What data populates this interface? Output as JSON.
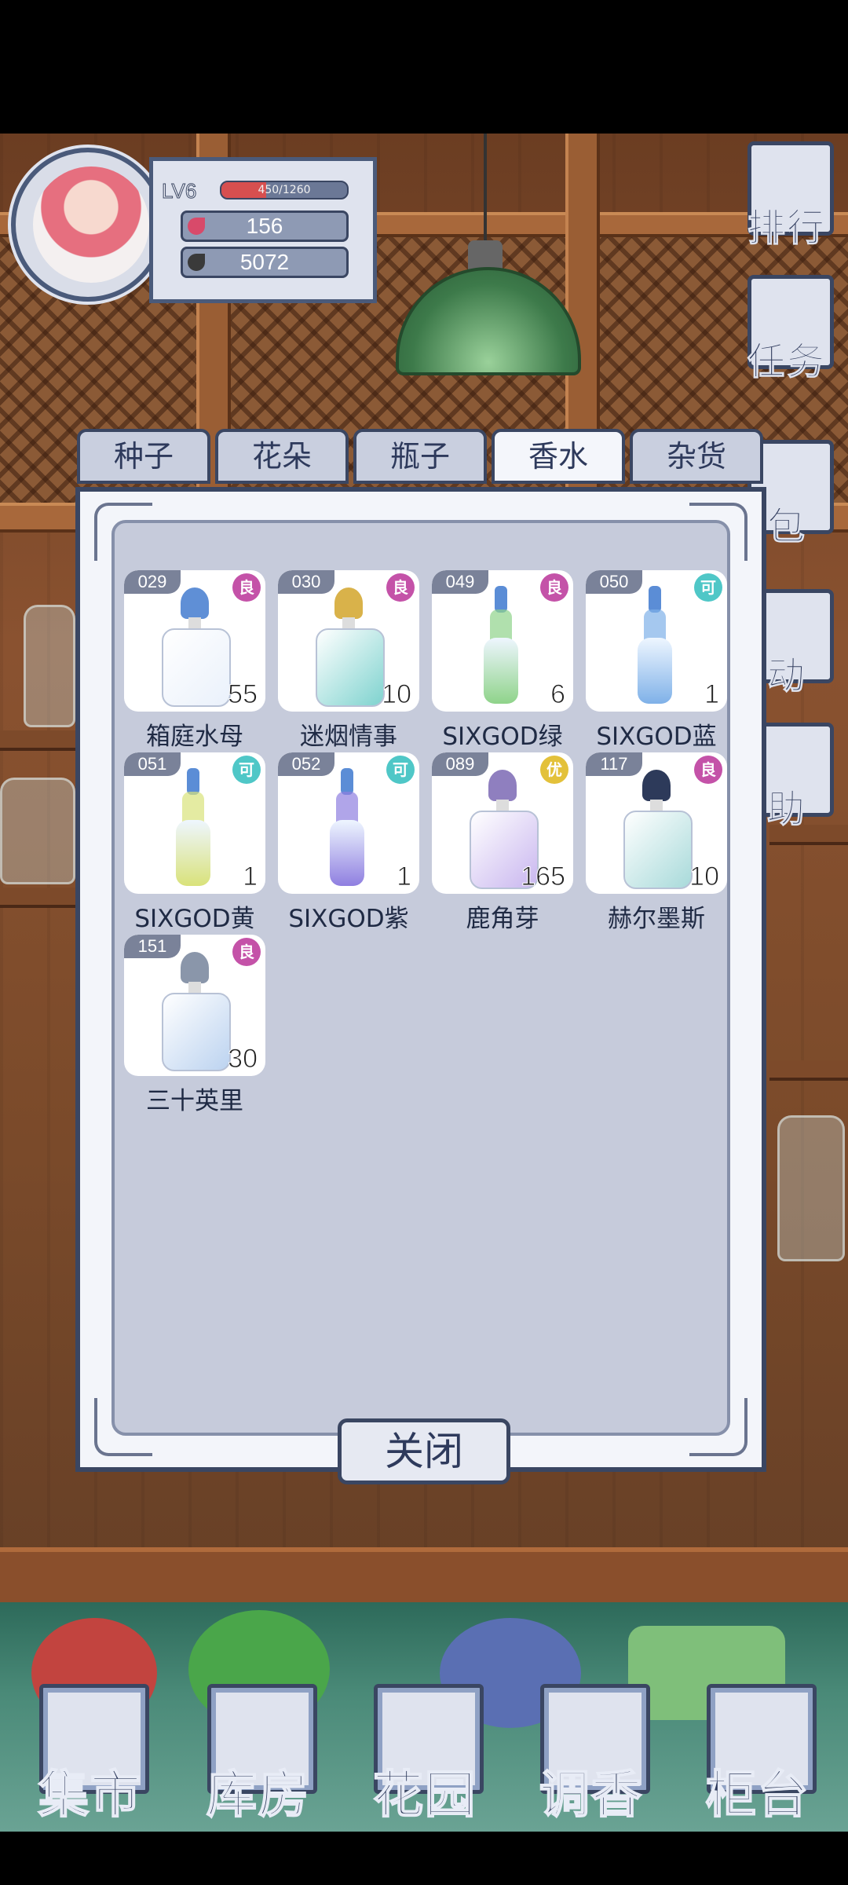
{
  "hud": {
    "level": "LV6",
    "xp_text": "450/1260",
    "xp_fraction": 0.357,
    "currency_1": "156",
    "currency_2": "5072"
  },
  "side_buttons": [
    "排行",
    "任务",
    "包",
    "动",
    "助"
  ],
  "tabs": [
    {
      "label": "种子",
      "active": false
    },
    {
      "label": "花朵",
      "active": false
    },
    {
      "label": "瓶子",
      "active": false
    },
    {
      "label": "香水",
      "active": true
    },
    {
      "label": "杂货",
      "active": false
    }
  ],
  "items": [
    {
      "id": "029",
      "rarity": "良",
      "rarity_color": "#c452a8",
      "count": "55",
      "name": "箱庭水母",
      "icon": "perfume-bottle-blue-cap"
    },
    {
      "id": "030",
      "rarity": "良",
      "rarity_color": "#c452a8",
      "count": "10",
      "name": "迷烟情事",
      "icon": "perfume-bottle-teal-gold"
    },
    {
      "id": "049",
      "rarity": "良",
      "rarity_color": "#c452a8",
      "count": "6",
      "name": "SIXGOD绿",
      "icon": "sixgod-bottle-green"
    },
    {
      "id": "050",
      "rarity": "可",
      "rarity_color": "#4fc7c7",
      "count": "1",
      "name": "SIXGOD蓝",
      "icon": "sixgod-bottle-blue"
    },
    {
      "id": "051",
      "rarity": "可",
      "rarity_color": "#4fc7c7",
      "count": "1",
      "name": "SIXGOD黄",
      "icon": "sixgod-bottle-yellow"
    },
    {
      "id": "052",
      "rarity": "可",
      "rarity_color": "#4fc7c7",
      "count": "1",
      "name": "SIXGOD紫",
      "icon": "sixgod-bottle-purple"
    },
    {
      "id": "089",
      "rarity": "优",
      "rarity_color": "#e3c13a",
      "count": "165",
      "name": "鹿角芽",
      "icon": "perfume-bottle-lilac"
    },
    {
      "id": "117",
      "rarity": "良",
      "rarity_color": "#c452a8",
      "count": "10",
      "name": "赫尔墨斯",
      "icon": "perfume-bottle-square"
    },
    {
      "id": "151",
      "rarity": "良",
      "rarity_color": "#c452a8",
      "count": "30",
      "name": "三十英里",
      "icon": "perfume-bottle-feather"
    }
  ],
  "close_label": "关闭",
  "nav": [
    "集市",
    "库房",
    "花园",
    "调香",
    "柜台"
  ]
}
